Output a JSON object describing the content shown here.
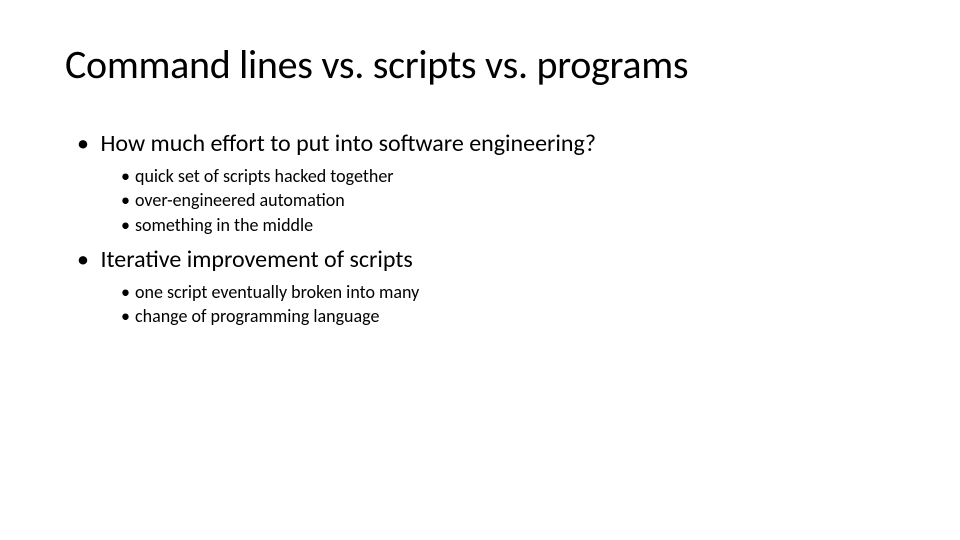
{
  "title": "Command lines vs. scripts vs. programs",
  "bullets": [
    {
      "text": "How much effort to put into software engineering?",
      "children": [
        {
          "text": "quick set of scripts hacked together"
        },
        {
          "text": "over-engineered automation"
        },
        {
          "text": "something in the middle"
        }
      ]
    },
    {
      "text": "Iterative improvement of scripts",
      "children": [
        {
          "text": "one script eventually broken into many"
        },
        {
          "text": "change of programming language"
        }
      ]
    }
  ]
}
